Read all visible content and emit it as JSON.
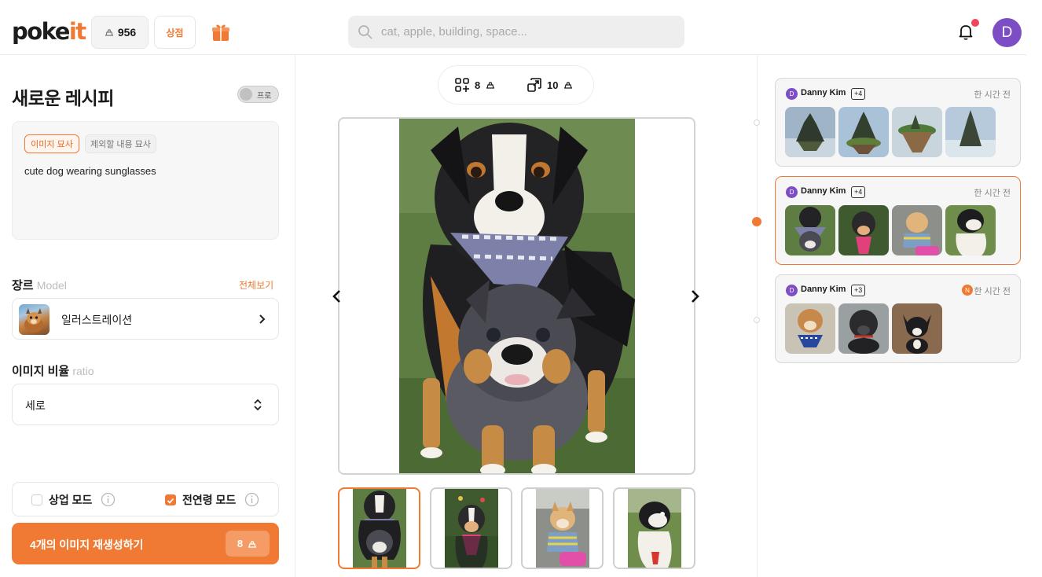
{
  "header": {
    "logo_main": "poke",
    "logo_accent": "it",
    "coins": "956",
    "store_label": "상점",
    "search_placeholder": "cat, apple, building, space...",
    "avatar_initial": "D"
  },
  "recipe": {
    "title": "새로운 레시피",
    "pro_label": "프로",
    "tab_describe": "이미지 묘사",
    "tab_exclude": "제외할 내용 묘사",
    "prompt": "cute dog wearing sunglasses",
    "genre_label": "장르",
    "genre_sub": "Model",
    "see_all": "전체보기",
    "model_name": "일러스트레이션",
    "ratio_label": "이미지 비율",
    "ratio_sub": "ratio",
    "ratio_value": "세로",
    "commercial_mode": "상업 모드",
    "all_ages_mode": "전연령 모드",
    "commercial_checked": false,
    "all_ages_checked": true,
    "regen_label": "4개의 이미지 재생성하기",
    "regen_cost": "8"
  },
  "viewer": {
    "generate_cost": "8",
    "upscale_cost": "10"
  },
  "history": [
    {
      "initial": "D",
      "user": "Danny Kim",
      "count": "+4",
      "time": "한 시간 전",
      "badge": ""
    },
    {
      "initial": "D",
      "user": "Danny Kim",
      "count": "+4",
      "time": "한 시간 전",
      "badge": ""
    },
    {
      "initial": "D",
      "user": "Danny Kim",
      "count": "+3",
      "time": "한 시간 전",
      "badge": "N"
    }
  ],
  "colors": {
    "accent": "#f07a33",
    "avatar": "#7c4dc4",
    "notification": "#f0475f"
  }
}
